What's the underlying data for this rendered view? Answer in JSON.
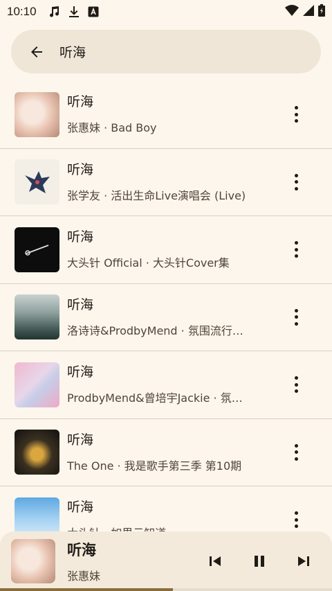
{
  "status_bar": {
    "time": "10:10"
  },
  "search": {
    "query": "听海"
  },
  "results": [
    {
      "title": "听海",
      "subtitle": "张惠妹 · Bad Boy"
    },
    {
      "title": "听海",
      "subtitle": "张学友 · 活出生命Live演唱会 (Live)"
    },
    {
      "title": "听海",
      "subtitle": "大头针 Official · 大头针Cover集"
    },
    {
      "title": "听海",
      "subtitle": "洛诗诗&ProdbyMend · 氛围流行…"
    },
    {
      "title": "听海",
      "subtitle": "ProdbyMend&曾培宇Jackie · 氛…"
    },
    {
      "title": "听海",
      "subtitle": "The One · 我是歌手第三季 第10期"
    },
    {
      "title": "听海",
      "subtitle": "大头针 · 如果云知道"
    }
  ],
  "player": {
    "title": "听海",
    "artist": "张惠妹",
    "progress": 0.52
  },
  "colors": {
    "background": "#fdf6ec",
    "search_bg": "#efe6d8",
    "player_bg": "#f4eadb",
    "accent": "#8a6d3b"
  }
}
